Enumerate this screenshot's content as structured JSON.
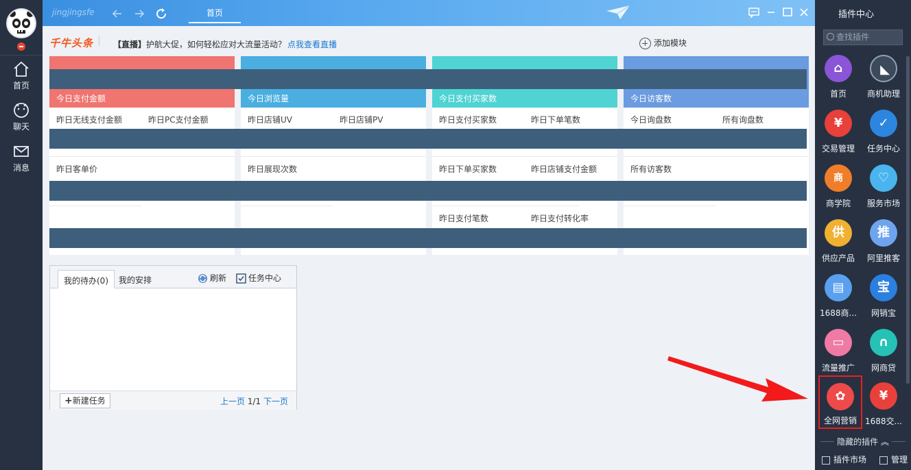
{
  "left_nav": {
    "items": [
      {
        "label": "首页",
        "icon": "home-icon"
      },
      {
        "label": "聊天",
        "icon": "chat-icon"
      },
      {
        "label": "消息",
        "icon": "mail-icon"
      }
    ]
  },
  "topbar": {
    "username": "jingjingsfe",
    "tab": "首页"
  },
  "headline": {
    "brand": "千牛头条",
    "tag": "【直播】",
    "text": "护航大促，如何轻松应对大流量活动？",
    "link": "点我查看直播",
    "add_module": "添加模块"
  },
  "cards": [
    {
      "color": "#f07470",
      "title": "今日支付金额",
      "rows": [
        [
          "昨日无线支付金额",
          "昨日PC支付金额"
        ],
        [
          "昨日客单价",
          ""
        ],
        [
          "",
          ""
        ]
      ]
    },
    {
      "color": "#4aaee0",
      "title": "今日浏览量",
      "rows": [
        [
          "昨日店铺UV",
          "昨日店铺PV"
        ],
        [
          "昨日展现次数",
          ""
        ],
        [
          "",
          ""
        ]
      ]
    },
    {
      "color": "#4fd3d3",
      "title": "今日支付买家数",
      "rows": [
        [
          "昨日支付买家数",
          "昨日下单笔数"
        ],
        [
          "昨日下单买家数",
          "昨日店铺支付金额"
        ],
        [
          "昨日支付笔数",
          "昨日支付转化率"
        ]
      ]
    },
    {
      "color": "#6b9be0",
      "title": "今日访客数",
      "rows": [
        [
          "今日询盘数",
          "所有询盘数"
        ],
        [
          "所有访客数",
          ""
        ],
        [
          "",
          ""
        ]
      ]
    }
  ],
  "tasks": {
    "tab_todo": "我的待办(0)",
    "tab_schedule": "我的安排",
    "refresh": "刷新",
    "task_center": "任务中心",
    "new_task": "新建任务",
    "prev": "上一页",
    "page": "1/1",
    "next": "下一页"
  },
  "plugin_bar": {
    "title": "插件中心",
    "search_placeholder": "查找插件",
    "plugins": [
      {
        "label": "首页",
        "color": "#8a55d6",
        "glyph": "⌂",
        "icon": "home-icon"
      },
      {
        "label": "商机助理",
        "color": "#3d4a5c",
        "glyph": "◣",
        "icon": "business-assistant-icon"
      },
      {
        "label": "交易管理",
        "color": "#e8403a",
        "glyph": "¥",
        "icon": "trade-icon"
      },
      {
        "label": "任务中心",
        "color": "#2c86e0",
        "glyph": "✓",
        "icon": "calendar-check-icon"
      },
      {
        "label": "商学院",
        "color": "#f07d2a",
        "glyph": "商",
        "icon": "academy-icon"
      },
      {
        "label": "服务市场",
        "color": "#4ab4ef",
        "glyph": "♡",
        "icon": "heart-icon"
      },
      {
        "label": "供应产品",
        "color": "#f0b030",
        "glyph": "供",
        "icon": "supply-icon"
      },
      {
        "label": "阿里推客",
        "color": "#6ea4ee",
        "glyph": "推",
        "icon": "promote-icon"
      },
      {
        "label": "1688商...",
        "color": "#5aa0ef",
        "glyph": "▤",
        "icon": "box-icon"
      },
      {
        "label": "网销宝",
        "color": "#2b7fde",
        "glyph": "宝",
        "icon": "treasure-icon"
      },
      {
        "label": "流量推广",
        "color": "#ef7aa4",
        "glyph": "▭",
        "icon": "traffic-icon"
      },
      {
        "label": "网商贷",
        "color": "#26c2b6",
        "glyph": "∩",
        "icon": "loan-icon"
      },
      {
        "label": "全网营销",
        "color": "#ee4a4a",
        "glyph": "✿",
        "icon": "marketing-icon"
      },
      {
        "label": "1688交...",
        "color": "#e8403a",
        "glyph": "¥",
        "icon": "trade-icon"
      }
    ],
    "hidden": "隐藏的插件",
    "market": "插件市场",
    "manage": "管理"
  }
}
